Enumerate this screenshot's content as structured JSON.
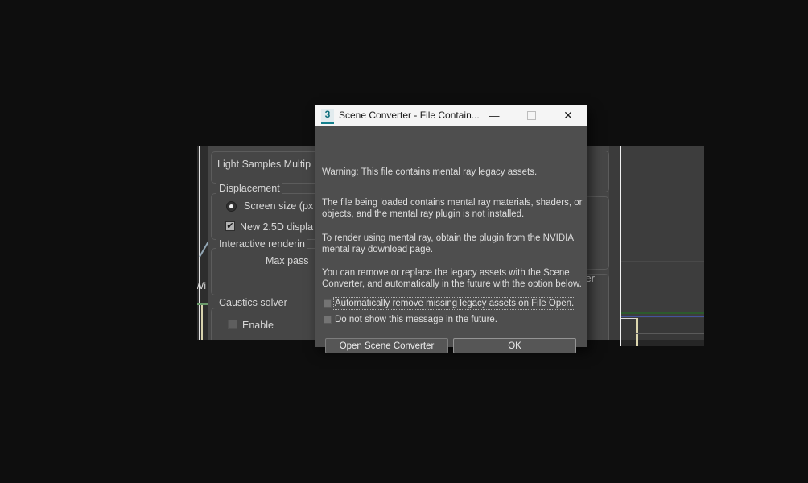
{
  "colors": {
    "desktop_background": "#0e0e0e",
    "panel_gray": "#464646",
    "dialog_body": "#4e4e4e",
    "titlebar": "#f5f5f5",
    "accent_teal": "#15808d",
    "viewport_green_line": "#2d5a2d",
    "viewport_blue_line": "#44549a",
    "viewport_cream_line": "#dcd7ae"
  },
  "background_window": {
    "left_viewport": {
      "label": "Wi"
    },
    "settings_panel": {
      "light_samples_label": "Light Samples Multip",
      "displacement_group": {
        "title": "Displacement",
        "screen_size_radio": "Screen size (px",
        "displace_checkbox": "New 2.5D displa",
        "displace_check_glyph": "✔"
      },
      "interactive_group": {
        "title": "Interactive renderin",
        "max_pass_label": "Max pass"
      },
      "caustics_group": {
        "title": "Caustics solver",
        "enable_checkbox": "Enable"
      },
      "right_fragment_label": "ler"
    }
  },
  "dialog": {
    "app_icon_glyph": "3",
    "title": "Scene Converter - File Contain...",
    "controls": {
      "minimize": "—",
      "close": "✕"
    },
    "paragraphs": [
      "Warning: This file contains mental ray legacy assets.",
      "The file being loaded contains mental ray materials, shaders, or\nobjects, and the mental ray plugin is not installed.",
      "To render using mental ray, obtain the plugin from the NVIDIA\nmental ray download page.",
      "You can remove or replace the legacy assets with the Scene\nConverter, and automatically in the future with the option below."
    ],
    "checkboxes": [
      {
        "label": "Automatically remove missing legacy assets on File Open.",
        "checked": false,
        "focused": true
      },
      {
        "label": "Do not show this message in the future.",
        "checked": false,
        "focused": false
      }
    ],
    "buttons": [
      {
        "label": "Open Scene Converter"
      },
      {
        "label": "OK"
      }
    ]
  }
}
